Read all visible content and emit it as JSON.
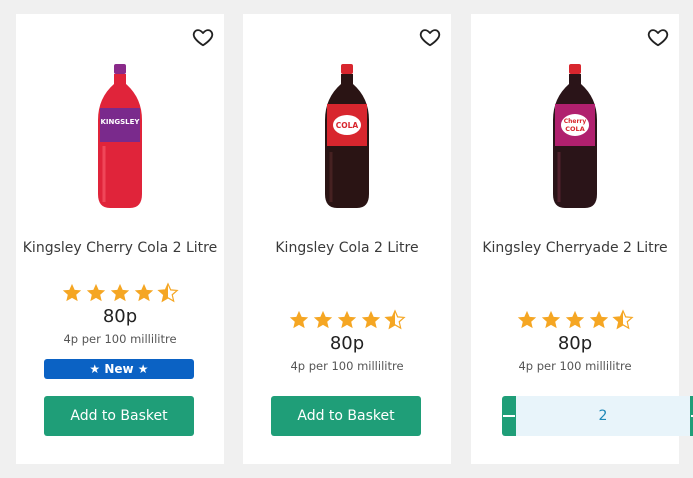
{
  "products": [
    {
      "title": "Kingsley Cherry Cola 2 Litre",
      "rating": 4.5,
      "price": "80p",
      "unit_price": "4p per 100 millilitre",
      "badge": "★ New ★",
      "action_label": "Add to Basket",
      "bottle_label": "KINGSLEY",
      "bottle_color": "#e0243a",
      "cap_color": "#8a2a8a"
    },
    {
      "title": "Kingsley Cola 2 Litre",
      "rating": 4.5,
      "price": "80p",
      "unit_price": "4p per 100 millilitre",
      "action_label": "Add to Basket",
      "bottle_label": "COLA",
      "bottle_color": "#2a1414",
      "cap_color": "#d8262e"
    },
    {
      "title": "Kingsley Cherryade 2 Litre",
      "rating": 4.5,
      "price": "80p",
      "unit_price": "4p per 100 millilitre",
      "quantity": "2",
      "bottle_label": "Cherry COLA",
      "bottle_color": "#2a1418",
      "cap_color": "#d8262e"
    }
  ],
  "colors": {
    "star": "#f5a623",
    "button": "#1f9e78",
    "badge": "#0b62c4",
    "stepper_bg": "#e8f4fa"
  },
  "icons": {
    "favorite": "heart-outline-icon",
    "star": "star-icon",
    "half_star": "half-star-icon",
    "minus": "minus-icon",
    "plus": "plus-icon"
  }
}
